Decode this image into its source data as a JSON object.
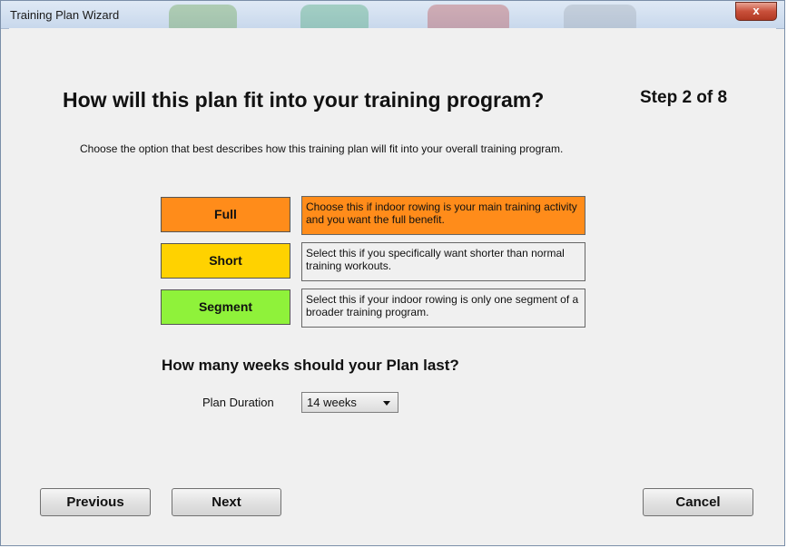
{
  "window": {
    "title": "Training Plan Wizard",
    "close_label": "x"
  },
  "page": {
    "heading": "How will this plan fit into your training program?",
    "step": "Step 2 of 8",
    "instruction": "Choose the option that best describes how this training plan will fit into your overall training program."
  },
  "options": [
    {
      "label": "Full",
      "color": "#ff8c1a",
      "description": "Choose this if indoor rowing is your main training activity and you want the full benefit."
    },
    {
      "label": "Short",
      "color": "#ffd200",
      "description": "Select this if you specifically want shorter than normal training workouts."
    },
    {
      "label": "Segment",
      "color": "#8ff23a",
      "description": "Select this if your indoor rowing is only one segment of a broader training program."
    }
  ],
  "duration": {
    "question": "How many weeks should your Plan last?",
    "label": "Plan Duration",
    "selected": "14 weeks"
  },
  "buttons": {
    "previous": "Previous",
    "next": "Next",
    "cancel": "Cancel"
  }
}
